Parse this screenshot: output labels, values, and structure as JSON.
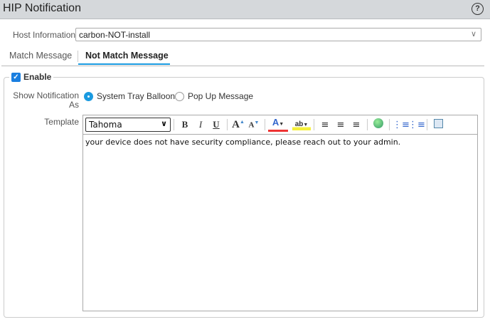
{
  "header": {
    "title": "HIP Notification",
    "help_icon": "question-circle-icon"
  },
  "host": {
    "label": "Host Information",
    "value": "carbon-NOT-install"
  },
  "tabs": [
    {
      "label": "Match Message",
      "active": false
    },
    {
      "label": "Not Match Message",
      "active": true
    }
  ],
  "enable": {
    "label": "Enable",
    "checked": true
  },
  "show_as": {
    "label": "Show Notification As",
    "options": [
      {
        "label": "System Tray Balloon",
        "selected": true
      },
      {
        "label": "Pop Up Message",
        "selected": false
      }
    ]
  },
  "template": {
    "label": "Template",
    "font": "Tahoma",
    "content": "your device does not have security compliance, please reach out to your admin."
  },
  "toolbar_icons": [
    "bold-icon",
    "italic-icon",
    "underline-icon",
    "grow-font-icon",
    "shrink-font-icon",
    "font-color-icon",
    "highlight-icon",
    "align-left-icon",
    "align-center-icon",
    "align-right-icon",
    "link-icon",
    "ordered-list-icon",
    "bullet-list-icon",
    "source-edit-icon"
  ],
  "colors": {
    "accent": "#1a9ae0",
    "font_color": "#e33",
    "highlight": "#f5f03a"
  }
}
